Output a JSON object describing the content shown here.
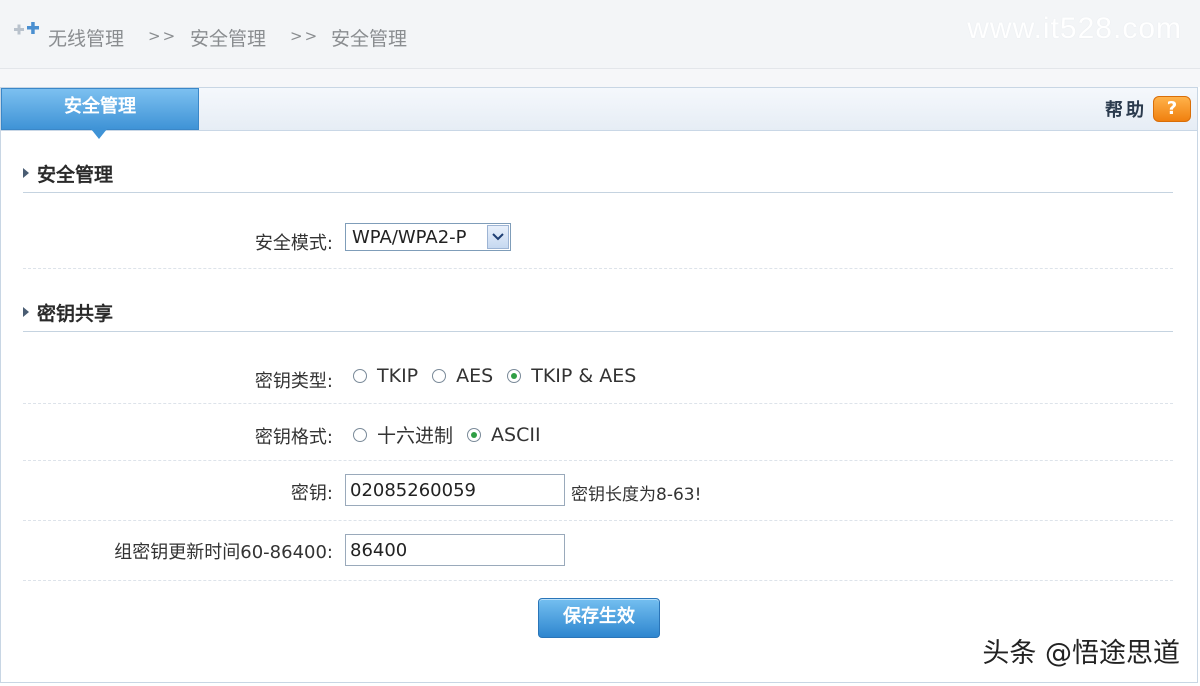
{
  "breadcrumb": {
    "items": [
      "无线管理",
      "安全管理",
      "安全管理"
    ],
    "separator": ">>"
  },
  "watermark_top": "www.it528.com",
  "tab": {
    "label": "安全管理"
  },
  "help": {
    "label": "帮助",
    "icon": "?"
  },
  "sections": {
    "security": {
      "title": "安全管理"
    },
    "keyshare": {
      "title": "密钥共享"
    }
  },
  "form": {
    "security_mode": {
      "label": "安全模式:",
      "value": "WPA/WPA2-P"
    },
    "key_type": {
      "label": "密钥类型:",
      "options": [
        "TKIP",
        "AES",
        "TKIP & AES"
      ],
      "selected": "TKIP & AES"
    },
    "key_format": {
      "label": "密钥格式:",
      "options": [
        "十六进制",
        "ASCII"
      ],
      "selected": "ASCII"
    },
    "key": {
      "label": "密钥:",
      "value": "02085260059",
      "hint": "密钥长度为8-63!"
    },
    "group_rekey": {
      "label": "组密钥更新时间60-86400:",
      "value": "86400"
    }
  },
  "save_button": {
    "label": "保存生效"
  },
  "watermark_bottom": "头条 @悟途思道",
  "colors": {
    "accent": "#3f93d6",
    "help": "#f0800f",
    "radio_check": "#2f9e44"
  }
}
